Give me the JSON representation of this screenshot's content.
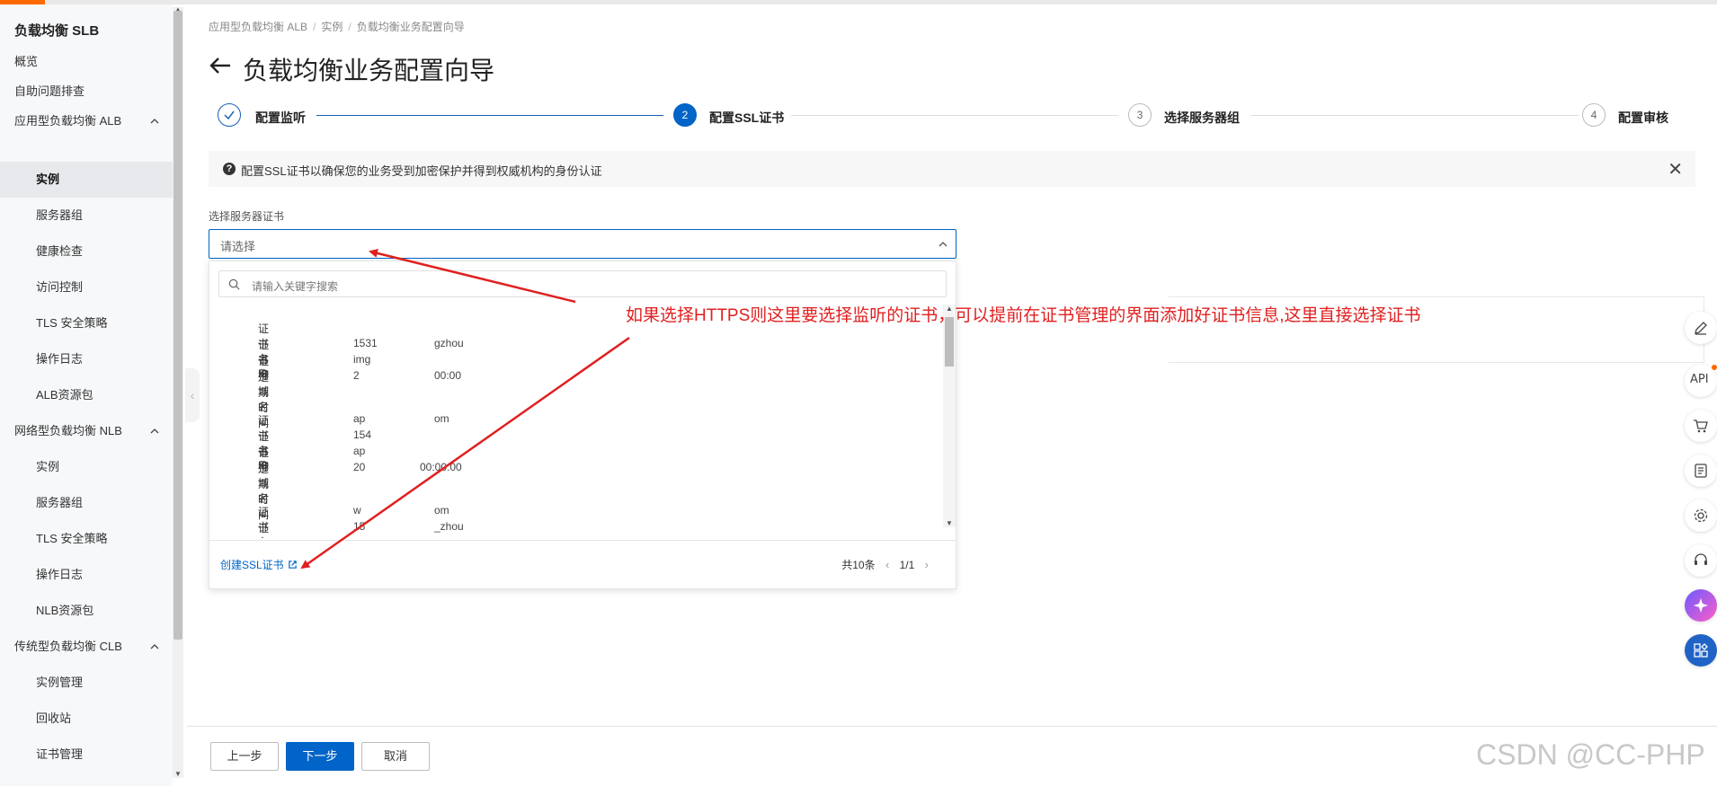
{
  "sidebar": {
    "title": "负载均衡 SLB",
    "items": [
      "概览",
      "自助问题排查"
    ],
    "groups": [
      {
        "label": "应用型负载均衡 ALB",
        "items": [
          "实例",
          "服务器组",
          "健康检查",
          "访问控制",
          "TLS 安全策略",
          "操作日志",
          "ALB资源包"
        ]
      },
      {
        "label": "网络型负载均衡 NLB",
        "items": [
          "实例",
          "服务器组",
          "TLS 安全策略",
          "操作日志",
          "NLB资源包"
        ]
      },
      {
        "label": "传统型负载均衡 CLB",
        "items": [
          "实例管理",
          "回收站",
          "证书管理"
        ]
      }
    ]
  },
  "breadcrumb": [
    "应用型负载均衡 ALB",
    "实例",
    "负载均衡业务配置向导"
  ],
  "page_title": "负载均衡业务配置向导",
  "steps": [
    {
      "num": "",
      "label": "配置监听",
      "state": "done"
    },
    {
      "num": "2",
      "label": "配置SSL证书",
      "state": "active"
    },
    {
      "num": "3",
      "label": "选择服务器组",
      "state": "pending"
    },
    {
      "num": "4",
      "label": "配置审核",
      "state": "pending"
    }
  ],
  "notice": {
    "text": "配置SSL证书以确保您的业务受到加密保护并得到权威机构的身份认证"
  },
  "cert_field": {
    "label": "选择服务器证书",
    "placeholder": "请选择",
    "search_placeholder": "请输入关键字搜索"
  },
  "certs": [
    {
      "name": "",
      "id": "1531",
      "id_tail": "gzhou",
      "domain": "img",
      "expire": "2",
      "expire_tail": "00:00"
    },
    {
      "name": "ap",
      "name_tail": "om",
      "id": "154",
      "domain": "ap",
      "expire": "20",
      "expire_tail": "00:00:00"
    },
    {
      "name": "w",
      "name_tail": "om",
      "id": "15",
      "id_tail": "_zhou"
    }
  ],
  "cert_labels": {
    "name": "证书名称",
    "id": "证书ID",
    "domain": "证书域名",
    "expire": "过期时间"
  },
  "dropdown_footer": {
    "create_link": "创建SSL证书",
    "total": "共10条",
    "page": "1/1"
  },
  "annotation": "如果选择HTTPS则这里要选择监听的证书，可以提前在证书管理的界面添加好证书信息,这里直接选择证书",
  "right_toolbar": [
    "edit-icon",
    "api-icon",
    "cart-icon",
    "coupon-icon",
    "settings-icon",
    "support-icon",
    "ai-assistant-icon",
    "apps-icon"
  ],
  "api_label": "API",
  "buttons": {
    "prev": "上一步",
    "next": "下一步",
    "cancel": "取消"
  },
  "watermark": "CSDN @CC-PHP",
  "colors": {
    "primary": "#0064c8",
    "annotation": "#e02020",
    "brand": "#ff6a00"
  }
}
